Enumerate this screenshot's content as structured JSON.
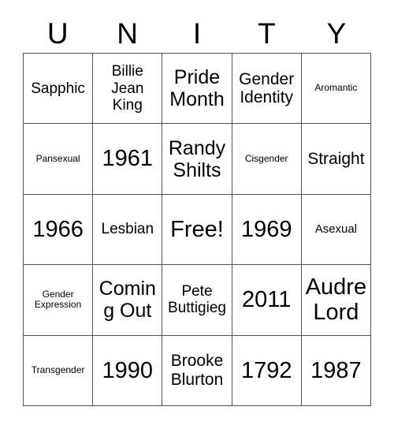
{
  "card": {
    "header_letters": [
      "U",
      "N",
      "I",
      "T",
      "Y"
    ],
    "free_space_label": "Free!",
    "grid": [
      [
        {
          "text": "Sapphic",
          "size": "sm"
        },
        {
          "text": "Billie Jean King",
          "size": "sm"
        },
        {
          "text": "Pride Month",
          "size": "lg"
        },
        {
          "text": "Gender Identity",
          "size": "md"
        },
        {
          "text": "Aromantic",
          "size": "xxs"
        }
      ],
      [
        {
          "text": "Pansexual",
          "size": "xxs"
        },
        {
          "text": "1961",
          "size": "xl"
        },
        {
          "text": "Randy Shilts",
          "size": "lg"
        },
        {
          "text": "Cisgender",
          "size": "xxs"
        },
        {
          "text": "Straight",
          "size": "md"
        }
      ],
      [
        {
          "text": "1966",
          "size": "xl"
        },
        {
          "text": "Lesbian",
          "size": "sm"
        },
        {
          "text": "Free!",
          "size": "xl"
        },
        {
          "text": "1969",
          "size": "xl"
        },
        {
          "text": "Asexual",
          "size": "xs"
        }
      ],
      [
        {
          "text": "Gender Expression",
          "size": "xxs"
        },
        {
          "text": "Coming Out",
          "size": "lg"
        },
        {
          "text": "Pete Buttigieg",
          "size": "sm"
        },
        {
          "text": "2011",
          "size": "xl"
        },
        {
          "text": "Audre Lord",
          "size": "xl"
        }
      ],
      [
        {
          "text": "Transgender",
          "size": "xxs"
        },
        {
          "text": "1990",
          "size": "xl"
        },
        {
          "text": "Brooke Blurton",
          "size": "md"
        },
        {
          "text": "1792",
          "size": "xl"
        },
        {
          "text": "1987",
          "size": "xl"
        }
      ]
    ]
  },
  "colors": {
    "background": "#ffffff",
    "text": "#000000",
    "grid_line": "#555555"
  }
}
